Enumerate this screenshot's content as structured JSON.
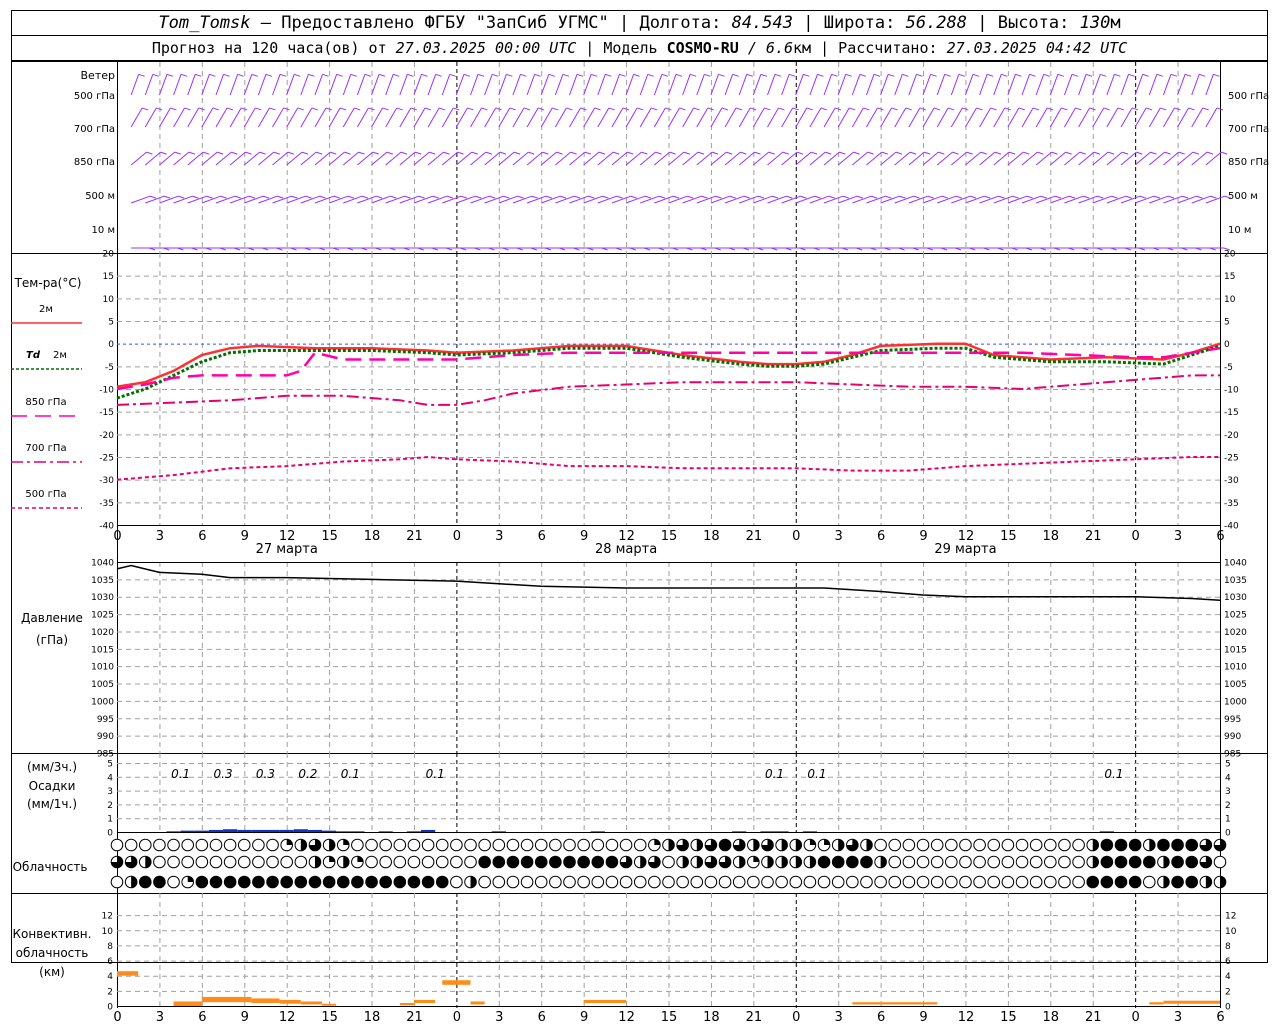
{
  "header": {
    "station": "Tom_Tomsk",
    "provided_by": " – Предоставлено ФГБУ \"ЗапСиб УГМС\" | Долгота: ",
    "longitude": "84.543",
    "lat_label": " | Широта: ",
    "latitude": "56.288",
    "alt_label": " | Высота: ",
    "altitude": "130",
    "alt_unit": "м",
    "forecast_label": "Прогноз на 120 часа(ов) от ",
    "forecast_start": "27.03.2025 00:00 UTC",
    "model_label": " | Модель ",
    "model": "COSMO-RU",
    "resolution": " / 6.6",
    "res_unit": "км",
    "computed_label": " | Рассчитано: ",
    "computed": "27.03.2025 04:42 UTC"
  },
  "colors": {
    "wind": "#9b30ff",
    "t2m": "#ff3030",
    "td2m": "#007000",
    "t850": "#ff00aa",
    "t700": "#e6006e",
    "t500": "#e6006e",
    "pressure": "#000000",
    "precip": "#1030c8",
    "convective": "#ff8c1a",
    "grid": "#a0a0a0"
  },
  "chart_data": [
    {
      "type": "barbs",
      "panel": "wind",
      "title": "Ветер",
      "levels": [
        "500 гПа",
        "700 гПа",
        "850 гПа",
        "500 м",
        "10 м"
      ]
    },
    {
      "type": "line",
      "panel": "temperature",
      "ylabel": "Тем-ра(°C)",
      "ylim": [
        -40,
        20
      ],
      "yticks": [
        20,
        15,
        10,
        5,
        0,
        -5,
        -10,
        -15,
        -20,
        -25,
        -30,
        -35,
        -40
      ],
      "xlim": [
        0,
        78
      ],
      "xtick_labels": [
        "0",
        "3",
        "6",
        "9",
        "12",
        "15",
        "18",
        "21",
        "0",
        "3",
        "6",
        "9",
        "12",
        "15",
        "18",
        "21",
        "0",
        "3",
        "6",
        "9",
        "12",
        "15",
        "18",
        "21",
        "0",
        "3",
        "6"
      ],
      "day_labels": [
        "27 марта",
        "28 марта",
        "29 марта"
      ],
      "grid": true,
      "legend_placement": "left",
      "series": [
        {
          "name": "2м",
          "style": "solid",
          "x": [
            0,
            2,
            4,
            6,
            8,
            10,
            14,
            18,
            22,
            24,
            28,
            32,
            36,
            40,
            44,
            46,
            48,
            50,
            52,
            54,
            58,
            60,
            62,
            64,
            66,
            70,
            74,
            76,
            78
          ],
          "y": [
            -9.5,
            -8.5,
            -6,
            -2.5,
            -1,
            -0.5,
            -1,
            -1,
            -1.5,
            -2,
            -1.5,
            -0.5,
            -0.5,
            -2.5,
            -4,
            -4.5,
            -4.5,
            -4,
            -2.5,
            -0.5,
            0,
            0,
            -2.5,
            -3,
            -3.5,
            -3,
            -3.5,
            -2,
            0
          ]
        },
        {
          "name": "Td 2м",
          "style": "dotted",
          "x": [
            0,
            2,
            4,
            6,
            8,
            10,
            14,
            18,
            22,
            24,
            28,
            32,
            36,
            40,
            44,
            46,
            48,
            50,
            52,
            54,
            58,
            60,
            62,
            64,
            66,
            70,
            74,
            76,
            78
          ],
          "y": [
            -12,
            -10,
            -7,
            -4,
            -2,
            -1.5,
            -1.5,
            -1.5,
            -2,
            -2.5,
            -2,
            -1,
            -1,
            -3,
            -4.5,
            -5,
            -5,
            -4.5,
            -3,
            -1.5,
            -1,
            -1,
            -3,
            -3.5,
            -4,
            -4,
            -4.5,
            -2.5,
            -0.5
          ]
        },
        {
          "name": "850 гПа",
          "style": "dashed",
          "x": [
            0,
            2,
            4,
            6,
            8,
            10,
            12,
            13,
            14,
            16,
            20,
            24,
            28,
            32,
            36,
            40,
            44,
            48,
            52,
            56,
            60,
            64,
            68,
            72,
            74,
            76,
            78
          ],
          "y": [
            -10,
            -9,
            -7.5,
            -7,
            -7,
            -7,
            -7,
            -6,
            -2,
            -3.5,
            -3.5,
            -3.5,
            -2.5,
            -2,
            -2,
            -2,
            -2,
            -2,
            -2,
            -2,
            -2,
            -2,
            -2.5,
            -3,
            -3,
            -2,
            -1
          ]
        },
        {
          "name": "700 гПа",
          "style": "dashdot",
          "x": [
            0,
            4,
            8,
            12,
            16,
            20,
            22,
            24,
            26,
            28,
            32,
            36,
            40,
            44,
            48,
            52,
            56,
            60,
            64,
            68,
            72,
            76,
            78
          ],
          "y": [
            -13.5,
            -13,
            -12.5,
            -11.5,
            -11.5,
            -12.5,
            -13.5,
            -13.5,
            -12.5,
            -11,
            -9.5,
            -9,
            -8.5,
            -8.5,
            -8.5,
            -9,
            -9.5,
            -9.5,
            -10,
            -9,
            -8,
            -7,
            -7
          ]
        },
        {
          "name": "500 гПа",
          "style": "dotted",
          "x": [
            0,
            4,
            8,
            12,
            16,
            20,
            22,
            24,
            28,
            32,
            36,
            40,
            44,
            48,
            52,
            56,
            60,
            64,
            68,
            72,
            76,
            78
          ],
          "y": [
            -30,
            -29,
            -27.5,
            -27,
            -26,
            -25.5,
            -25,
            -25.5,
            -26,
            -27,
            -27,
            -27.5,
            -27.5,
            -27.5,
            -28,
            -28,
            -27,
            -26.5,
            -26,
            -25.5,
            -25,
            -25
          ]
        }
      ]
    },
    {
      "type": "line",
      "panel": "pressure",
      "ylabel": "Давление",
      "yunit": "(гПа)",
      "ylim": [
        985,
        1040
      ],
      "yticks": [
        1040,
        1035,
        1030,
        1025,
        1020,
        1015,
        1010,
        1005,
        1000,
        995,
        990,
        985
      ],
      "grid": true,
      "series": [
        {
          "name": "pressure",
          "style": "solid",
          "x": [
            0,
            1,
            3,
            6,
            8,
            12,
            18,
            24,
            30,
            36,
            42,
            48,
            50,
            54,
            57,
            60,
            66,
            72,
            76,
            78
          ],
          "y": [
            1038,
            1039,
            1037,
            1036.5,
            1035.5,
            1035.5,
            1035,
            1034.5,
            1033,
            1032.5,
            1032.5,
            1032.5,
            1032.5,
            1031.5,
            1030.5,
            1030,
            1030,
            1030,
            1029.5,
            1029
          ]
        }
      ]
    },
    {
      "type": "bar",
      "panel": "precipitation",
      "ylabel": "Осадки",
      "yunit_top": "(мм/3ч.)",
      "yunit_bottom": "(мм/1ч.)",
      "ylim": [
        0,
        5
      ],
      "yticks": [
        5,
        4,
        3,
        2,
        1,
        0
      ],
      "labels_3h": [
        {
          "x": 4.5,
          "text": "0.1"
        },
        {
          "x": 7.5,
          "text": "0.3"
        },
        {
          "x": 10.5,
          "text": "0.3"
        },
        {
          "x": 13.5,
          "text": "0.2"
        },
        {
          "x": 16.5,
          "text": "0.1"
        },
        {
          "x": 22.5,
          "text": "0.1"
        },
        {
          "x": 46.5,
          "text": "0.1"
        },
        {
          "x": 49.5,
          "text": "0.1"
        },
        {
          "x": 70.5,
          "text": "0.1"
        }
      ],
      "x": [
        4,
        5,
        6,
        7,
        8,
        9,
        10,
        11,
        12,
        13,
        14,
        15,
        16,
        17,
        19,
        21,
        22,
        27,
        34,
        44,
        46,
        47,
        49,
        70
      ],
      "values": [
        0.05,
        0.1,
        0.1,
        0.15,
        0.2,
        0.15,
        0.15,
        0.15,
        0.15,
        0.2,
        0.15,
        0.1,
        0.05,
        0.05,
        0.05,
        0.05,
        0.15,
        0.05,
        0.05,
        0.05,
        0.05,
        0.05,
        0.05,
        0.05
      ]
    },
    {
      "type": "symbols",
      "panel": "cloudiness",
      "title": "Облачность",
      "levels": [
        "upper",
        "middle",
        "lower"
      ],
      "key": "fill fraction 0..1 per hour",
      "rows": [
        [
          0,
          0,
          0,
          0,
          0,
          0,
          0,
          0,
          0,
          0,
          0,
          0,
          0.25,
          0.5,
          0.75,
          0.5,
          0.25,
          0,
          0,
          0,
          0,
          0,
          0,
          0,
          0,
          0,
          0,
          0,
          0,
          0,
          0,
          0,
          0,
          0,
          0,
          0,
          0,
          0,
          0.25,
          0.5,
          0.75,
          0.5,
          0.75,
          1,
          0.75,
          0.5,
          0.75,
          0.5,
          0.5,
          0.25,
          0.25,
          0.5,
          0.75,
          0.5,
          0,
          0,
          0,
          0,
          0,
          0,
          0,
          0,
          0,
          0,
          0,
          0,
          0,
          0,
          0,
          0.5,
          1,
          1,
          1,
          0.5,
          1,
          1,
          1,
          0.75,
          0.75
        ],
        [
          0.75,
          0.75,
          0.5,
          0,
          0,
          0,
          0,
          0,
          0,
          0,
          0,
          0,
          0,
          0,
          0.5,
          0.25,
          0.5,
          0.25,
          0,
          0,
          0,
          0,
          0,
          0,
          0,
          0,
          1,
          1,
          1,
          1,
          1,
          1,
          1,
          1,
          1,
          1,
          0.75,
          0.5,
          0.75,
          0,
          0.5,
          0.5,
          0.75,
          0.75,
          0.5,
          0.25,
          0.5,
          0.5,
          0.5,
          0.5,
          1,
          1,
          1,
          1,
          0.5,
          0,
          0,
          0,
          0,
          0,
          0,
          0,
          0,
          0,
          0,
          0,
          0,
          0,
          0,
          0.5,
          1,
          1,
          1,
          1,
          0.5,
          1,
          1,
          0.75,
          0
        ],
        [
          0,
          0.5,
          1,
          1,
          0,
          0.25,
          1,
          1,
          1,
          1,
          1,
          1,
          1,
          1,
          1,
          1,
          1,
          1,
          1,
          1,
          1,
          1,
          1,
          1,
          0,
          0.5,
          0,
          0,
          0,
          0,
          0,
          0,
          0,
          0,
          0,
          0,
          0,
          0,
          0,
          0,
          0,
          0,
          0,
          0,
          0,
          0,
          0,
          0,
          0,
          0,
          0,
          0,
          0,
          0,
          0,
          0,
          0,
          0,
          0,
          0,
          0,
          0,
          0,
          0,
          0,
          0,
          0,
          0,
          0,
          1,
          1,
          1,
          1,
          0,
          0.5,
          1,
          1,
          0.5,
          0.5
        ]
      ]
    },
    {
      "type": "bar",
      "panel": "convective",
      "ylabel_lines": [
        "Конвективн.",
        "облачность",
        "(км)"
      ],
      "ylim": [
        0,
        14
      ],
      "yticks": [
        12,
        10,
        8,
        6,
        4,
        2,
        0
      ],
      "segments": [
        {
          "x0": 0,
          "x1": 1.5,
          "base": 4,
          "top": 4.6
        },
        {
          "x0": 4,
          "x1": 6,
          "base": 0,
          "top": 0.6
        },
        {
          "x0": 6,
          "x1": 9.5,
          "base": 0.5,
          "top": 1.2
        },
        {
          "x0": 9.5,
          "x1": 11.5,
          "base": 0.4,
          "top": 1.0
        },
        {
          "x0": 11.5,
          "x1": 13,
          "base": 0.3,
          "top": 0.8
        },
        {
          "x0": 13,
          "x1": 14.5,
          "base": 0.2,
          "top": 0.6
        },
        {
          "x0": 14.5,
          "x1": 15.5,
          "base": 0.1,
          "top": 0.3
        },
        {
          "x0": 20,
          "x1": 21,
          "base": 0.1,
          "top": 0.4
        },
        {
          "x0": 21,
          "x1": 22.5,
          "base": 0.4,
          "top": 0.8
        },
        {
          "x0": 23,
          "x1": 25,
          "base": 2.8,
          "top": 3.4
        },
        {
          "x0": 25,
          "x1": 26,
          "base": 0.2,
          "top": 0.6
        },
        {
          "x0": 33,
          "x1": 36,
          "base": 0.4,
          "top": 0.8
        },
        {
          "x0": 52,
          "x1": 58,
          "base": 0.2,
          "top": 0.5
        },
        {
          "x0": 73,
          "x1": 74,
          "base": 0.2,
          "top": 0.5
        },
        {
          "x0": 74,
          "x1": 78,
          "base": 0.3,
          "top": 0.7
        }
      ]
    }
  ]
}
